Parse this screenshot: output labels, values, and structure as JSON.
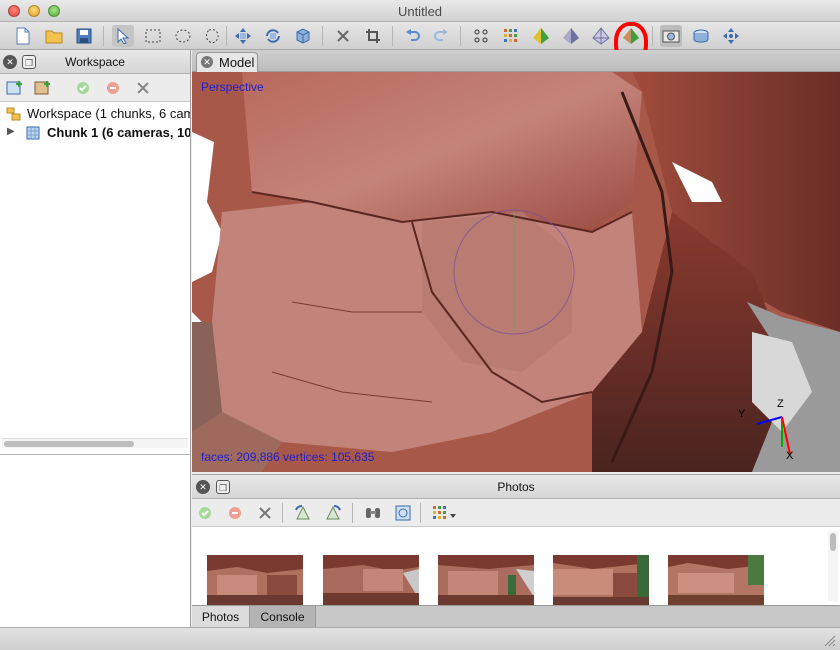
{
  "window": {
    "title": "Untitled"
  },
  "toolbar": {
    "buttons": [
      {
        "name": "new-document-icon",
        "glyph": "▯"
      },
      {
        "name": "open-folder-icon",
        "glyph": "▭"
      },
      {
        "name": "save-icon",
        "glyph": "▣"
      },
      {
        "name": "pointer-tool-icon",
        "glyph": "➤"
      },
      {
        "name": "rectangle-select-icon",
        "glyph": "⬚"
      },
      {
        "name": "circle-select-icon",
        "glyph": "◯"
      },
      {
        "name": "free-form-select-icon",
        "glyph": "◌"
      },
      {
        "name": "navigation-icon",
        "glyph": "✥"
      },
      {
        "name": "rotate-object-icon",
        "glyph": "↻"
      },
      {
        "name": "move-object-icon",
        "glyph": "⬗"
      },
      {
        "name": "delete-selection-icon",
        "glyph": "✕"
      },
      {
        "name": "crop-selection-icon",
        "glyph": "⌗"
      },
      {
        "name": "undo-icon",
        "glyph": "↶"
      },
      {
        "name": "redo-icon",
        "glyph": "↷"
      },
      {
        "name": "point-cloud-icon",
        "glyph": "⁘"
      },
      {
        "name": "dense-cloud-icon",
        "glyph": "▦"
      },
      {
        "name": "shaded-model-icon",
        "glyph": "◆"
      },
      {
        "name": "solid-model-icon",
        "glyph": "◆"
      },
      {
        "name": "wireframe-model-icon",
        "glyph": "◇"
      },
      {
        "name": "textured-model-icon",
        "glyph": "◈"
      },
      {
        "name": "show-cameras-icon",
        "glyph": "▣"
      },
      {
        "name": "show-region-icon",
        "glyph": "▤"
      },
      {
        "name": "reset-view-icon",
        "glyph": "✥"
      }
    ]
  },
  "workspace": {
    "title": "Workspace",
    "tree": {
      "root": "Workspace (1 chunks, 6 cameras)",
      "chunk": "Chunk 1 (6 cameras, 10"
    }
  },
  "model": {
    "tab_label": "Model",
    "view_label": "Perspective",
    "stats": "faces: 209,886 vertices: 105,635",
    "axes": {
      "x": "X",
      "y": "Y",
      "z": "Z"
    }
  },
  "photos": {
    "title": "Photos",
    "thumbnail_count": 5
  },
  "bottom_tabs": {
    "photos": "Photos",
    "console": "Console"
  }
}
